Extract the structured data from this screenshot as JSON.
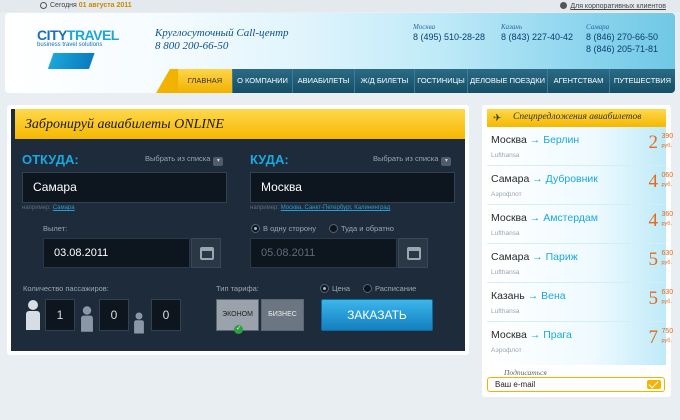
{
  "topbar": {
    "date_prefix": "Сегодня",
    "date_value": "01 августа 2011",
    "corporate_link": "Для корпоративных клиентов"
  },
  "header": {
    "logo_part1": "CITY",
    "logo_part2": "TRAVEL",
    "logo_sub": "business travel solutions",
    "call_center": "Круглосуточный Call-центр",
    "call_phone": "8 800 200-66-50",
    "cities": [
      {
        "name": "Москва",
        "phones": [
          "8 (495) 510-28-28"
        ]
      },
      {
        "name": "Казань",
        "phones": [
          "8 (843) 227-40-42"
        ]
      },
      {
        "name": "Самара",
        "phones": [
          "8 (846) 270-66-50",
          "8 (846) 205-71-81"
        ]
      }
    ]
  },
  "nav": [
    "ГЛАВНАЯ",
    "О КОМПАНИИ",
    "АВИАБИЛЕТЫ",
    "Ж/Д БИЛЕТЫ",
    "ГОСТИНИЦЫ",
    "ДЕЛОВЫЕ ПОЕЗДКИ",
    "АГЕНТСТВАМ",
    "ПУТЕШЕСТВИЯ"
  ],
  "booking": {
    "title": "Забронируй авиабилеты ONLINE",
    "from_label": "ОТКУДА:",
    "to_label": "КУДА:",
    "pick_list": "Выбрать из списка",
    "from_value": "Самара",
    "to_value": "Москва",
    "hint_prefix": "например:",
    "from_hint_link": "Самара",
    "to_hint_links": "Москва, Санкт-Петербург, Калининград",
    "depart_label": "Вылет:",
    "depart_date": "03.08.2011",
    "return_date": "05.08.2011",
    "one_way": "В одну сторону",
    "round_trip": "Туда и обратно",
    "passengers_label": "Количество пассажиров:",
    "passengers": [
      "1",
      "0",
      "0"
    ],
    "tariff_label": "Тип тарифа:",
    "tariff_economy": "ЭКОНОМ",
    "tariff_business": "БИЗНЕС",
    "sort_price": "Цена",
    "sort_schedule": "Расписание",
    "order_button": "ЗАКАЗАТЬ"
  },
  "specials": {
    "title": "Спецпредложения авиабилетов",
    "offers": [
      {
        "from": "Москва",
        "to": "Берлин",
        "airline": "Lufthansa",
        "price_big": "2",
        "price_small": "390",
        "currency": "руб."
      },
      {
        "from": "Самара",
        "to": "Дубровник",
        "airline": "Аэрофлот",
        "price_big": "4",
        "price_small": "060",
        "currency": "руб."
      },
      {
        "from": "Москва",
        "to": "Амстердам",
        "airline": "Lufthansa",
        "price_big": "4",
        "price_small": "360",
        "currency": "руб."
      },
      {
        "from": "Самара",
        "to": "Париж",
        "airline": "Lufthansa",
        "price_big": "5",
        "price_small": "630",
        "currency": "руб."
      },
      {
        "from": "Казань",
        "to": "Вена",
        "airline": "Lufthansa",
        "price_big": "5",
        "price_small": "630",
        "currency": "руб."
      },
      {
        "from": "Москва",
        "to": "Прага",
        "airline": "Аэрофлот",
        "price_big": "7",
        "price_small": "750",
        "currency": "руб."
      }
    ],
    "subscribe_label": "Подписаться",
    "email_placeholder": "Ваш e-mail"
  }
}
